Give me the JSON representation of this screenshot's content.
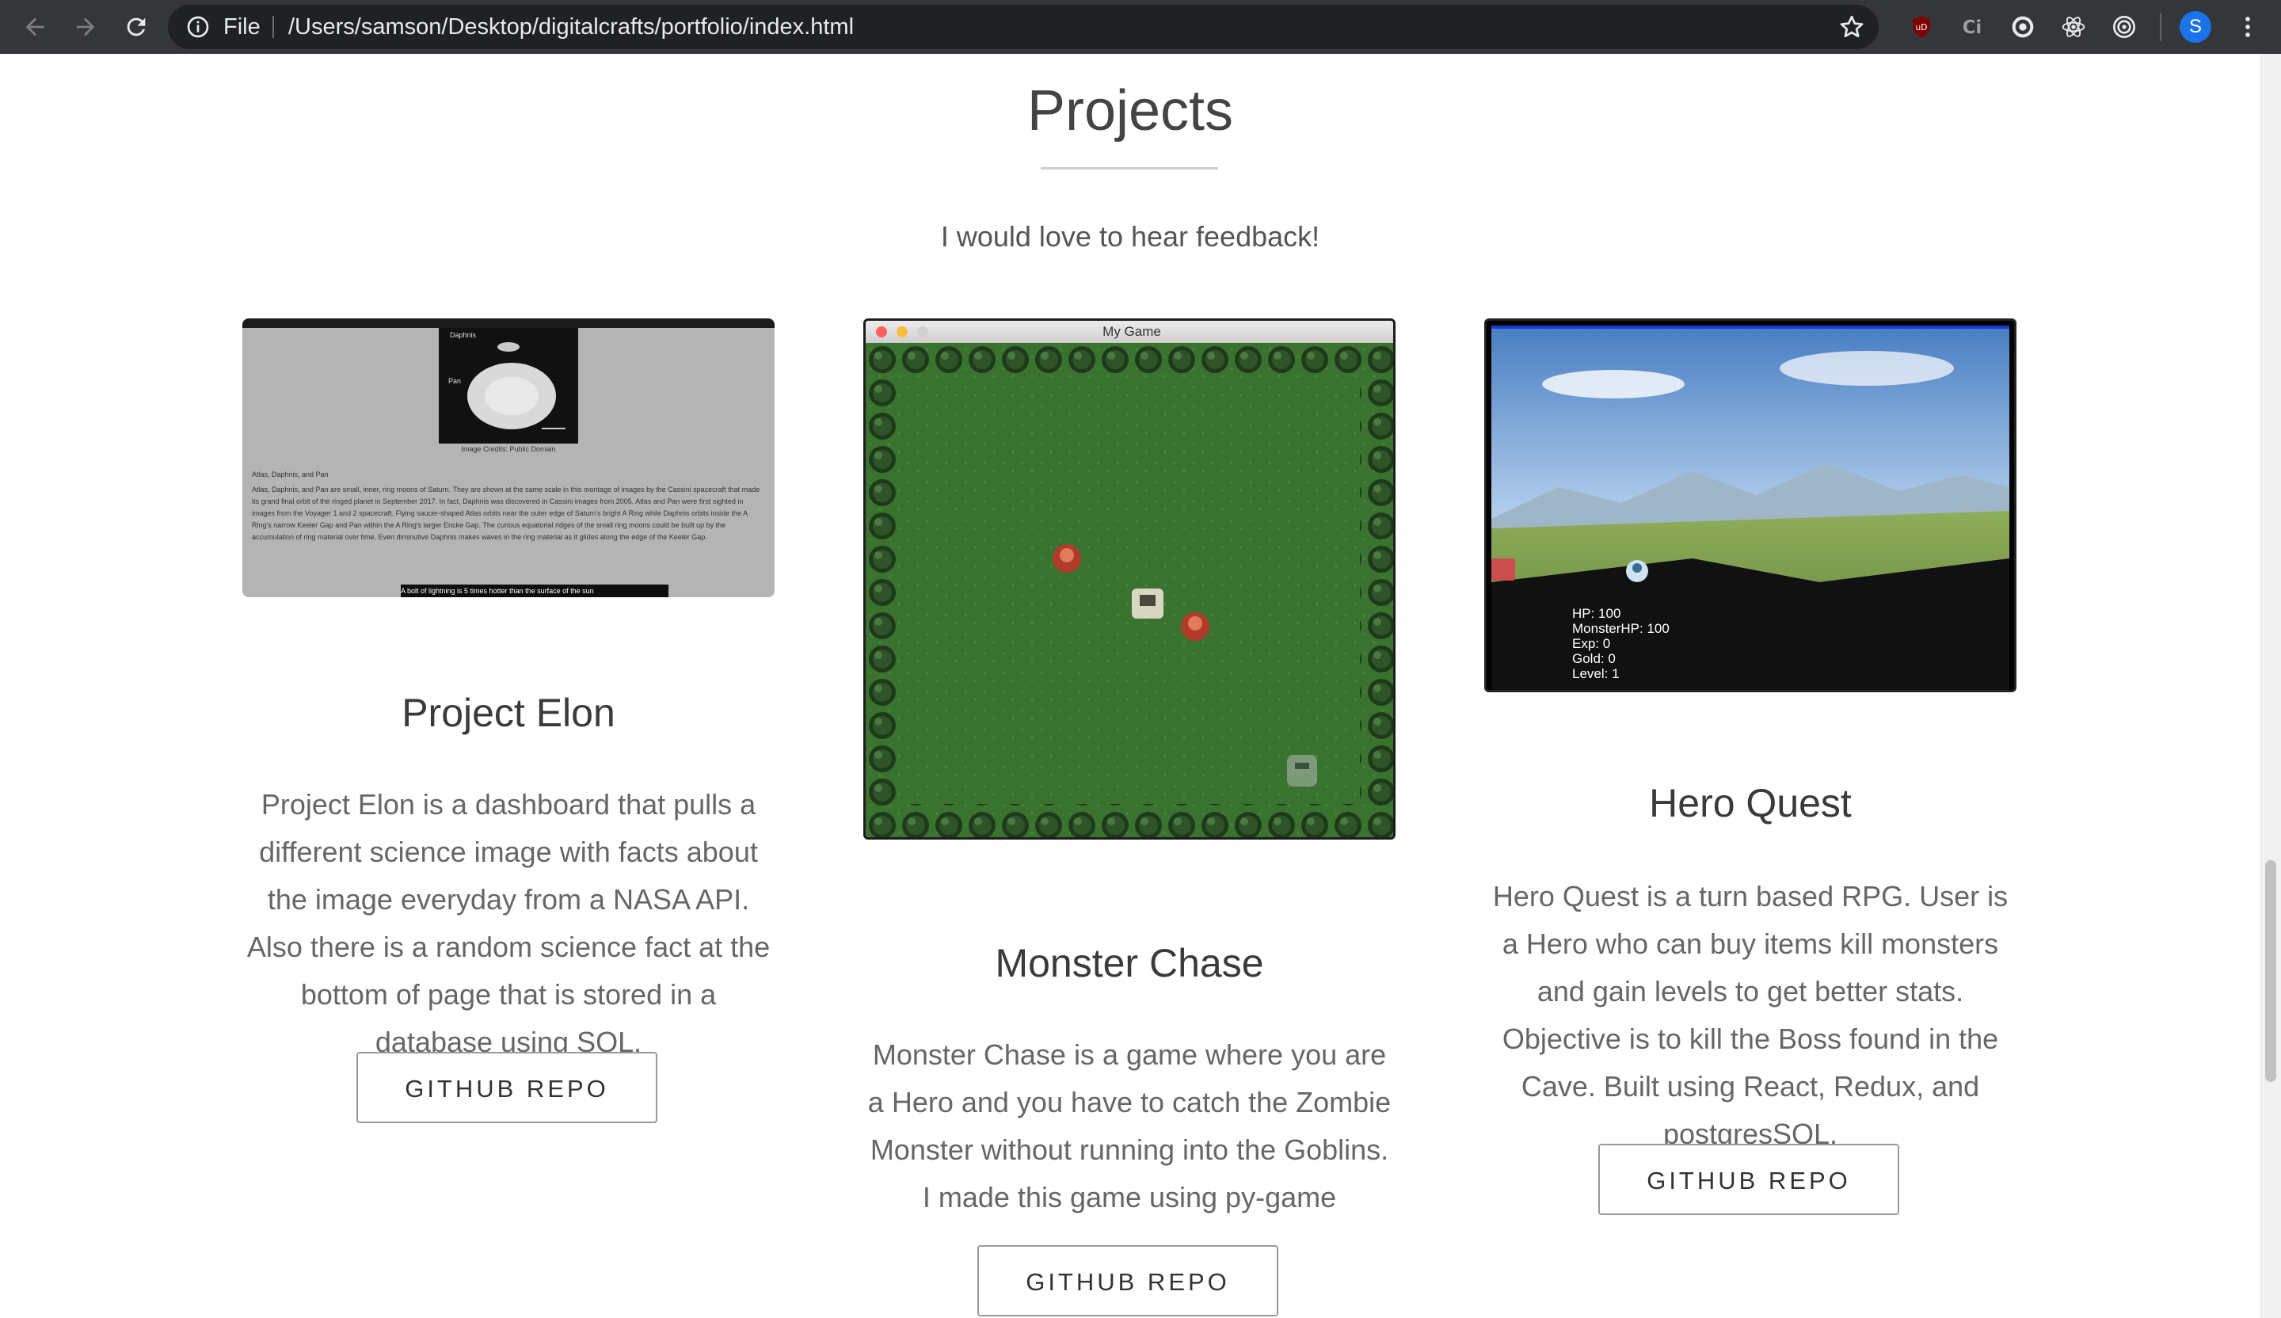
{
  "browser": {
    "scheme": "File",
    "url": "/Users/samson/Desktop/digitalcrafts/portfolio/index.html",
    "profile_initial": "S",
    "extensions": [
      "ublock-icon",
      "ci-icon",
      "chrome-icon",
      "react-icon",
      "target-icon"
    ]
  },
  "section": {
    "title": "Projects",
    "subtitle": "I would love to hear feedback!"
  },
  "projects": [
    {
      "title": "Project Elon",
      "description": "Project Elon is a dashboard that pulls a different science image with facts about the image everyday from a NASA API. Also there is a random science fact at the bottom of page that is stored in a database using SQL.",
      "button": "GITHUB REPO",
      "screenshot": {
        "caption_title": "Daphnis",
        "caption_pan": "Pan",
        "credit": "Image Credits: Public Domain",
        "heading": "Atlas, Daphnis, and Pan",
        "body": "Atlas, Daphnis, and Pan are small, inner, ring moons of Saturn. They are shown at the same scale in this montage of images by the Cassini spacecraft that made its grand final orbit of the ringed planet in September 2017. In fact, Daphnis was discovered in Cassini images from 2005. Atlas and Pan were first sighted in images from the Voyager 1 and 2 spacecraft. Flying saucer-shaped Atlas orbits near the outer edge of Saturn's bright A Ring while Daphnis orbits inside the A Ring's narrow Keeler Gap and Pan within the A Ring's larger Encke Gap. The curious equatorial ridges of the small ring moons could be built up by the accumulation of ring material over time. Even diminutive Daphnis makes waves in the ring material as it glides along the edge of the Keeler Gap.",
        "fact": "A bolt of lightning is 5 times hotter than the surface of the sun"
      }
    },
    {
      "title": "Monster Chase",
      "description": "Monster Chase is a game where you are a Hero and you have to catch the Zombie Monster without running into the Goblins. I made this game using py-game",
      "button": "GITHUB REPO",
      "screenshot": {
        "window_title": "My Game"
      }
    },
    {
      "title": "Hero Quest",
      "description": "Hero Quest is a turn based RPG. User is a Hero who can buy items kill monsters and gain levels to get better stats. Objective is to kill the Boss found in the Cave. Built using React, Redux, and postgresSQL.",
      "button": "GITHUB REPO",
      "screenshot": {
        "stats": [
          "HP: 100",
          "MonsterHP: 100",
          "Exp: 0",
          "Gold: 0",
          "Level: 1"
        ]
      }
    }
  ]
}
